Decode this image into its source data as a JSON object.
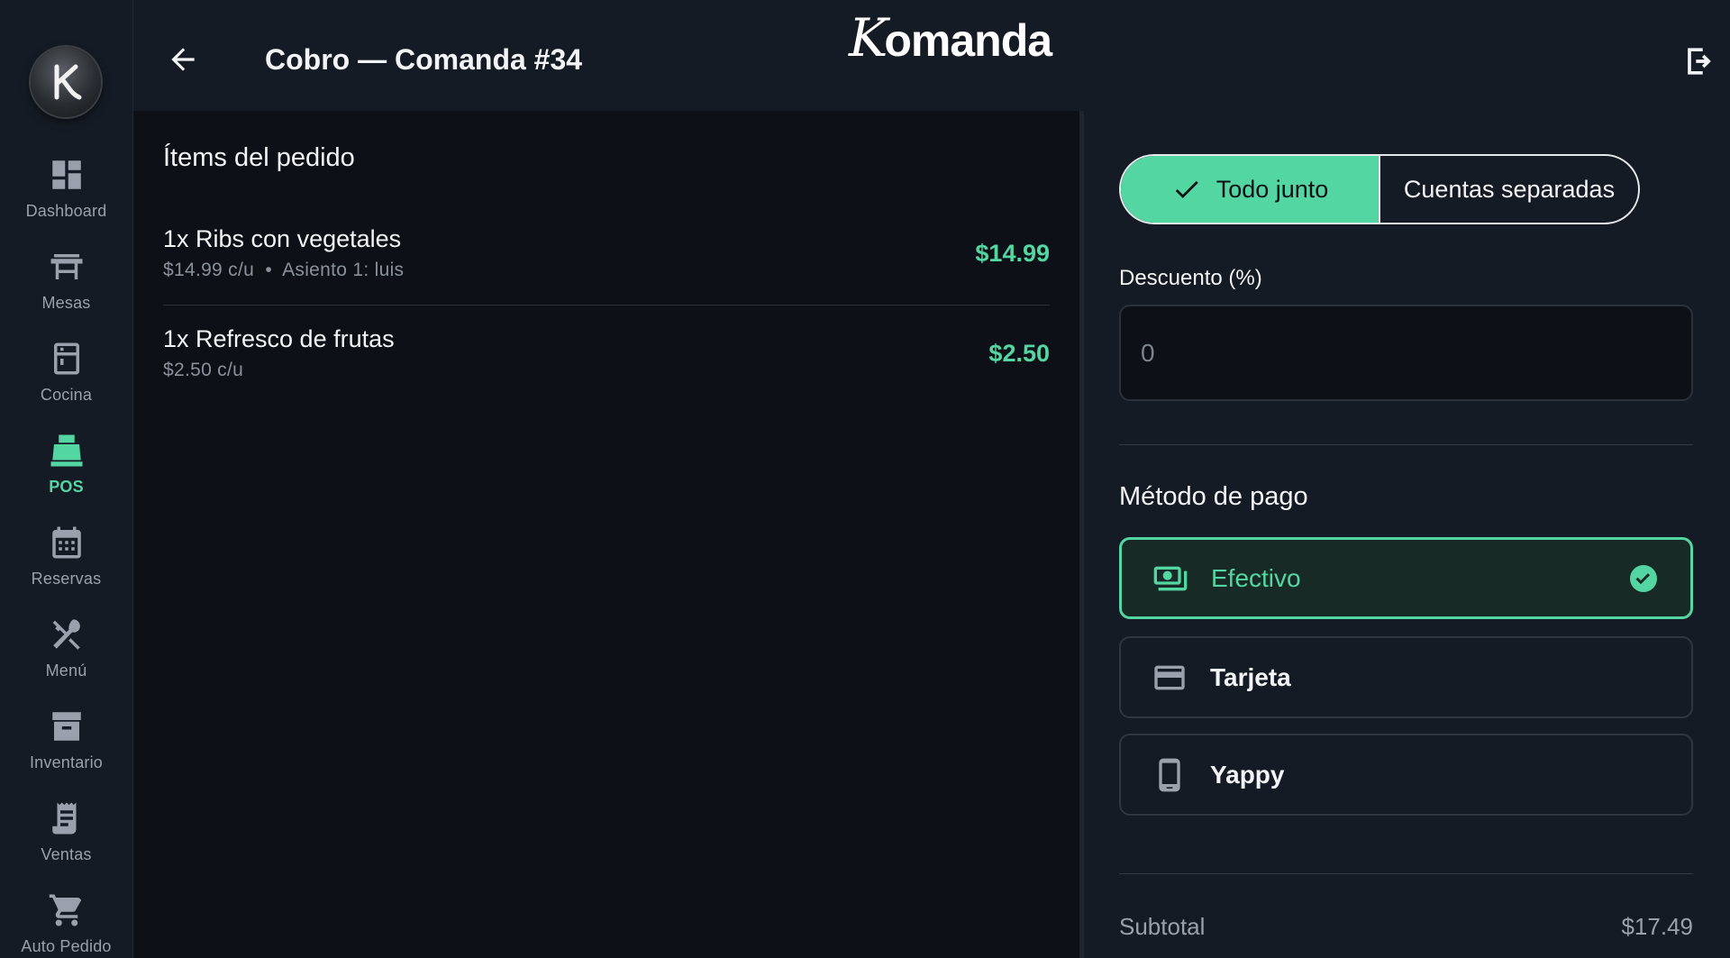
{
  "header": {
    "title": "Cobro — Comanda #34",
    "brand_initial": "K",
    "brand_rest": "omanda"
  },
  "sidebar": {
    "items": [
      {
        "label": "Dashboard",
        "icon": "dashboard-icon",
        "active": false
      },
      {
        "label": "Mesas",
        "icon": "table-icon",
        "active": false
      },
      {
        "label": "Cocina",
        "icon": "kitchen-icon",
        "active": false
      },
      {
        "label": "POS",
        "icon": "cash-register-icon",
        "active": true
      },
      {
        "label": "Reservas",
        "icon": "calendar-icon",
        "active": false
      },
      {
        "label": "Menú",
        "icon": "utensils-icon",
        "active": false
      },
      {
        "label": "Inventario",
        "icon": "archive-box-icon",
        "active": false
      },
      {
        "label": "Ventas",
        "icon": "receipt-icon",
        "active": false
      },
      {
        "label": "Auto Pedido",
        "icon": "cart-icon",
        "active": false
      }
    ]
  },
  "order": {
    "title": "Ítems del pedido",
    "items": [
      {
        "name": "1x Ribs con vegetales",
        "detail": "$14.99 c/u  •  Asiento 1: luis",
        "price": "$14.99"
      },
      {
        "name": "1x Refresco de frutas",
        "detail": "$2.50 c/u",
        "price": "$2.50"
      }
    ]
  },
  "payment": {
    "split_mode": {
      "together_label": "Todo junto",
      "separate_label": "Cuentas separadas",
      "selected": "together"
    },
    "discount": {
      "label": "Descuento (%)",
      "placeholder": "0",
      "value": ""
    },
    "method_title": "Método de pago",
    "methods": [
      {
        "label": "Efectivo",
        "icon": "cash-icon",
        "selected": true
      },
      {
        "label": "Tarjeta",
        "icon": "credit-card-icon",
        "selected": false
      },
      {
        "label": "Yappy",
        "icon": "phone-icon",
        "selected": false
      }
    ],
    "subtotal_label": "Subtotal",
    "subtotal_value": "$17.49"
  },
  "colors": {
    "accent": "#53d6a1",
    "panel": "#151b24",
    "background": "#0d1117",
    "muted_text": "#9aa1ac"
  }
}
